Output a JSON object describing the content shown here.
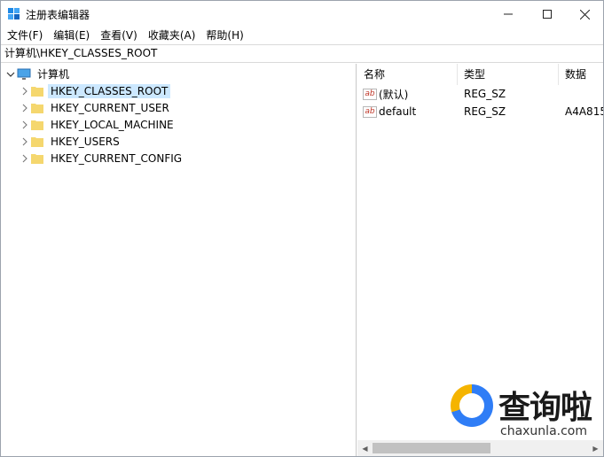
{
  "window": {
    "title": "注册表编辑器",
    "controls": {
      "minimize": "minimize-icon",
      "maximize": "maximize-icon",
      "close": "close-icon"
    }
  },
  "menubar": {
    "items": [
      "文件(F)",
      "编辑(E)",
      "查看(V)",
      "收藏夹(A)",
      "帮助(H)"
    ]
  },
  "address": "计算机\\HKEY_CLASSES_ROOT",
  "tree": {
    "root": "计算机",
    "items": [
      {
        "label": "HKEY_CLASSES_ROOT",
        "selected": true
      },
      {
        "label": "HKEY_CURRENT_USER",
        "selected": false
      },
      {
        "label": "HKEY_LOCAL_MACHINE",
        "selected": false
      },
      {
        "label": "HKEY_USERS",
        "selected": false
      },
      {
        "label": "HKEY_CURRENT_CONFIG",
        "selected": false
      }
    ]
  },
  "list": {
    "columns": {
      "name": "名称",
      "type": "类型",
      "data": "数据"
    },
    "rows": [
      {
        "name": "(默认)",
        "type": "REG_SZ",
        "data": ""
      },
      {
        "name": "default",
        "type": "REG_SZ",
        "data": "A4A815"
      }
    ]
  },
  "watermark": {
    "text": "查询啦",
    "sub": "chaxunla.com"
  },
  "colors": {
    "selection": "#cce8ff",
    "folder": "#f5d76e",
    "accent": "#2f7df6"
  }
}
